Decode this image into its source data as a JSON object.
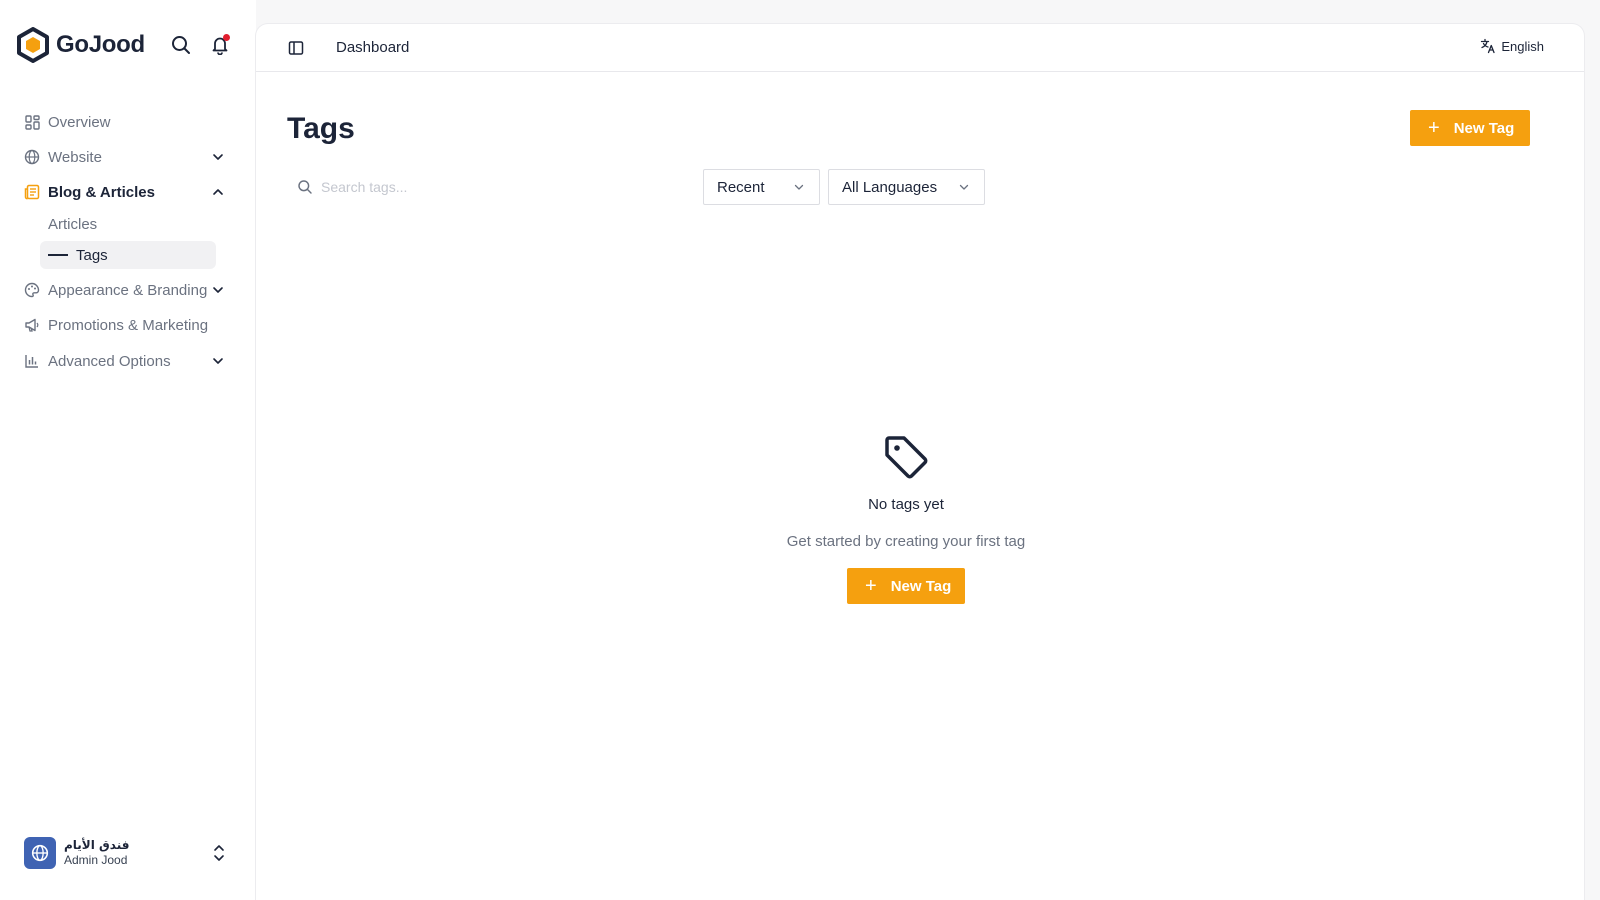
{
  "brand": {
    "name": "GoJood",
    "accent": "#f5a00f"
  },
  "header_icons": {
    "search": "search-icon",
    "notifications": "bell-icon",
    "notif_color": "#e11d2e"
  },
  "sidebar": {
    "items": [
      {
        "label": "Overview",
        "icon": "grid-icon"
      },
      {
        "label": "Website",
        "icon": "globe-icon"
      },
      {
        "label": "Blog & Articles",
        "icon": "newspaper-icon"
      },
      {
        "label": "Appearance & Branding",
        "icon": "palette-icon"
      },
      {
        "label": "Promotions & Marketing",
        "icon": "megaphone-icon"
      },
      {
        "label": "Advanced Options",
        "icon": "bar-chart-icon"
      }
    ],
    "sub_items": [
      {
        "label": "Articles"
      },
      {
        "label": "Tags"
      }
    ]
  },
  "account": {
    "org_name": "فندق الأيام",
    "user_name": "Admin Jood"
  },
  "topbar": {
    "breadcrumb": "Dashboard",
    "language": "English"
  },
  "page": {
    "title": "Tags",
    "new_button": "New Tag"
  },
  "filters": {
    "search_placeholder": "Search tags...",
    "sort": "Recent",
    "language": "All Languages"
  },
  "empty_state": {
    "title": "No tags yet",
    "description": "Get started by creating your first tag",
    "button": "New Tag"
  }
}
